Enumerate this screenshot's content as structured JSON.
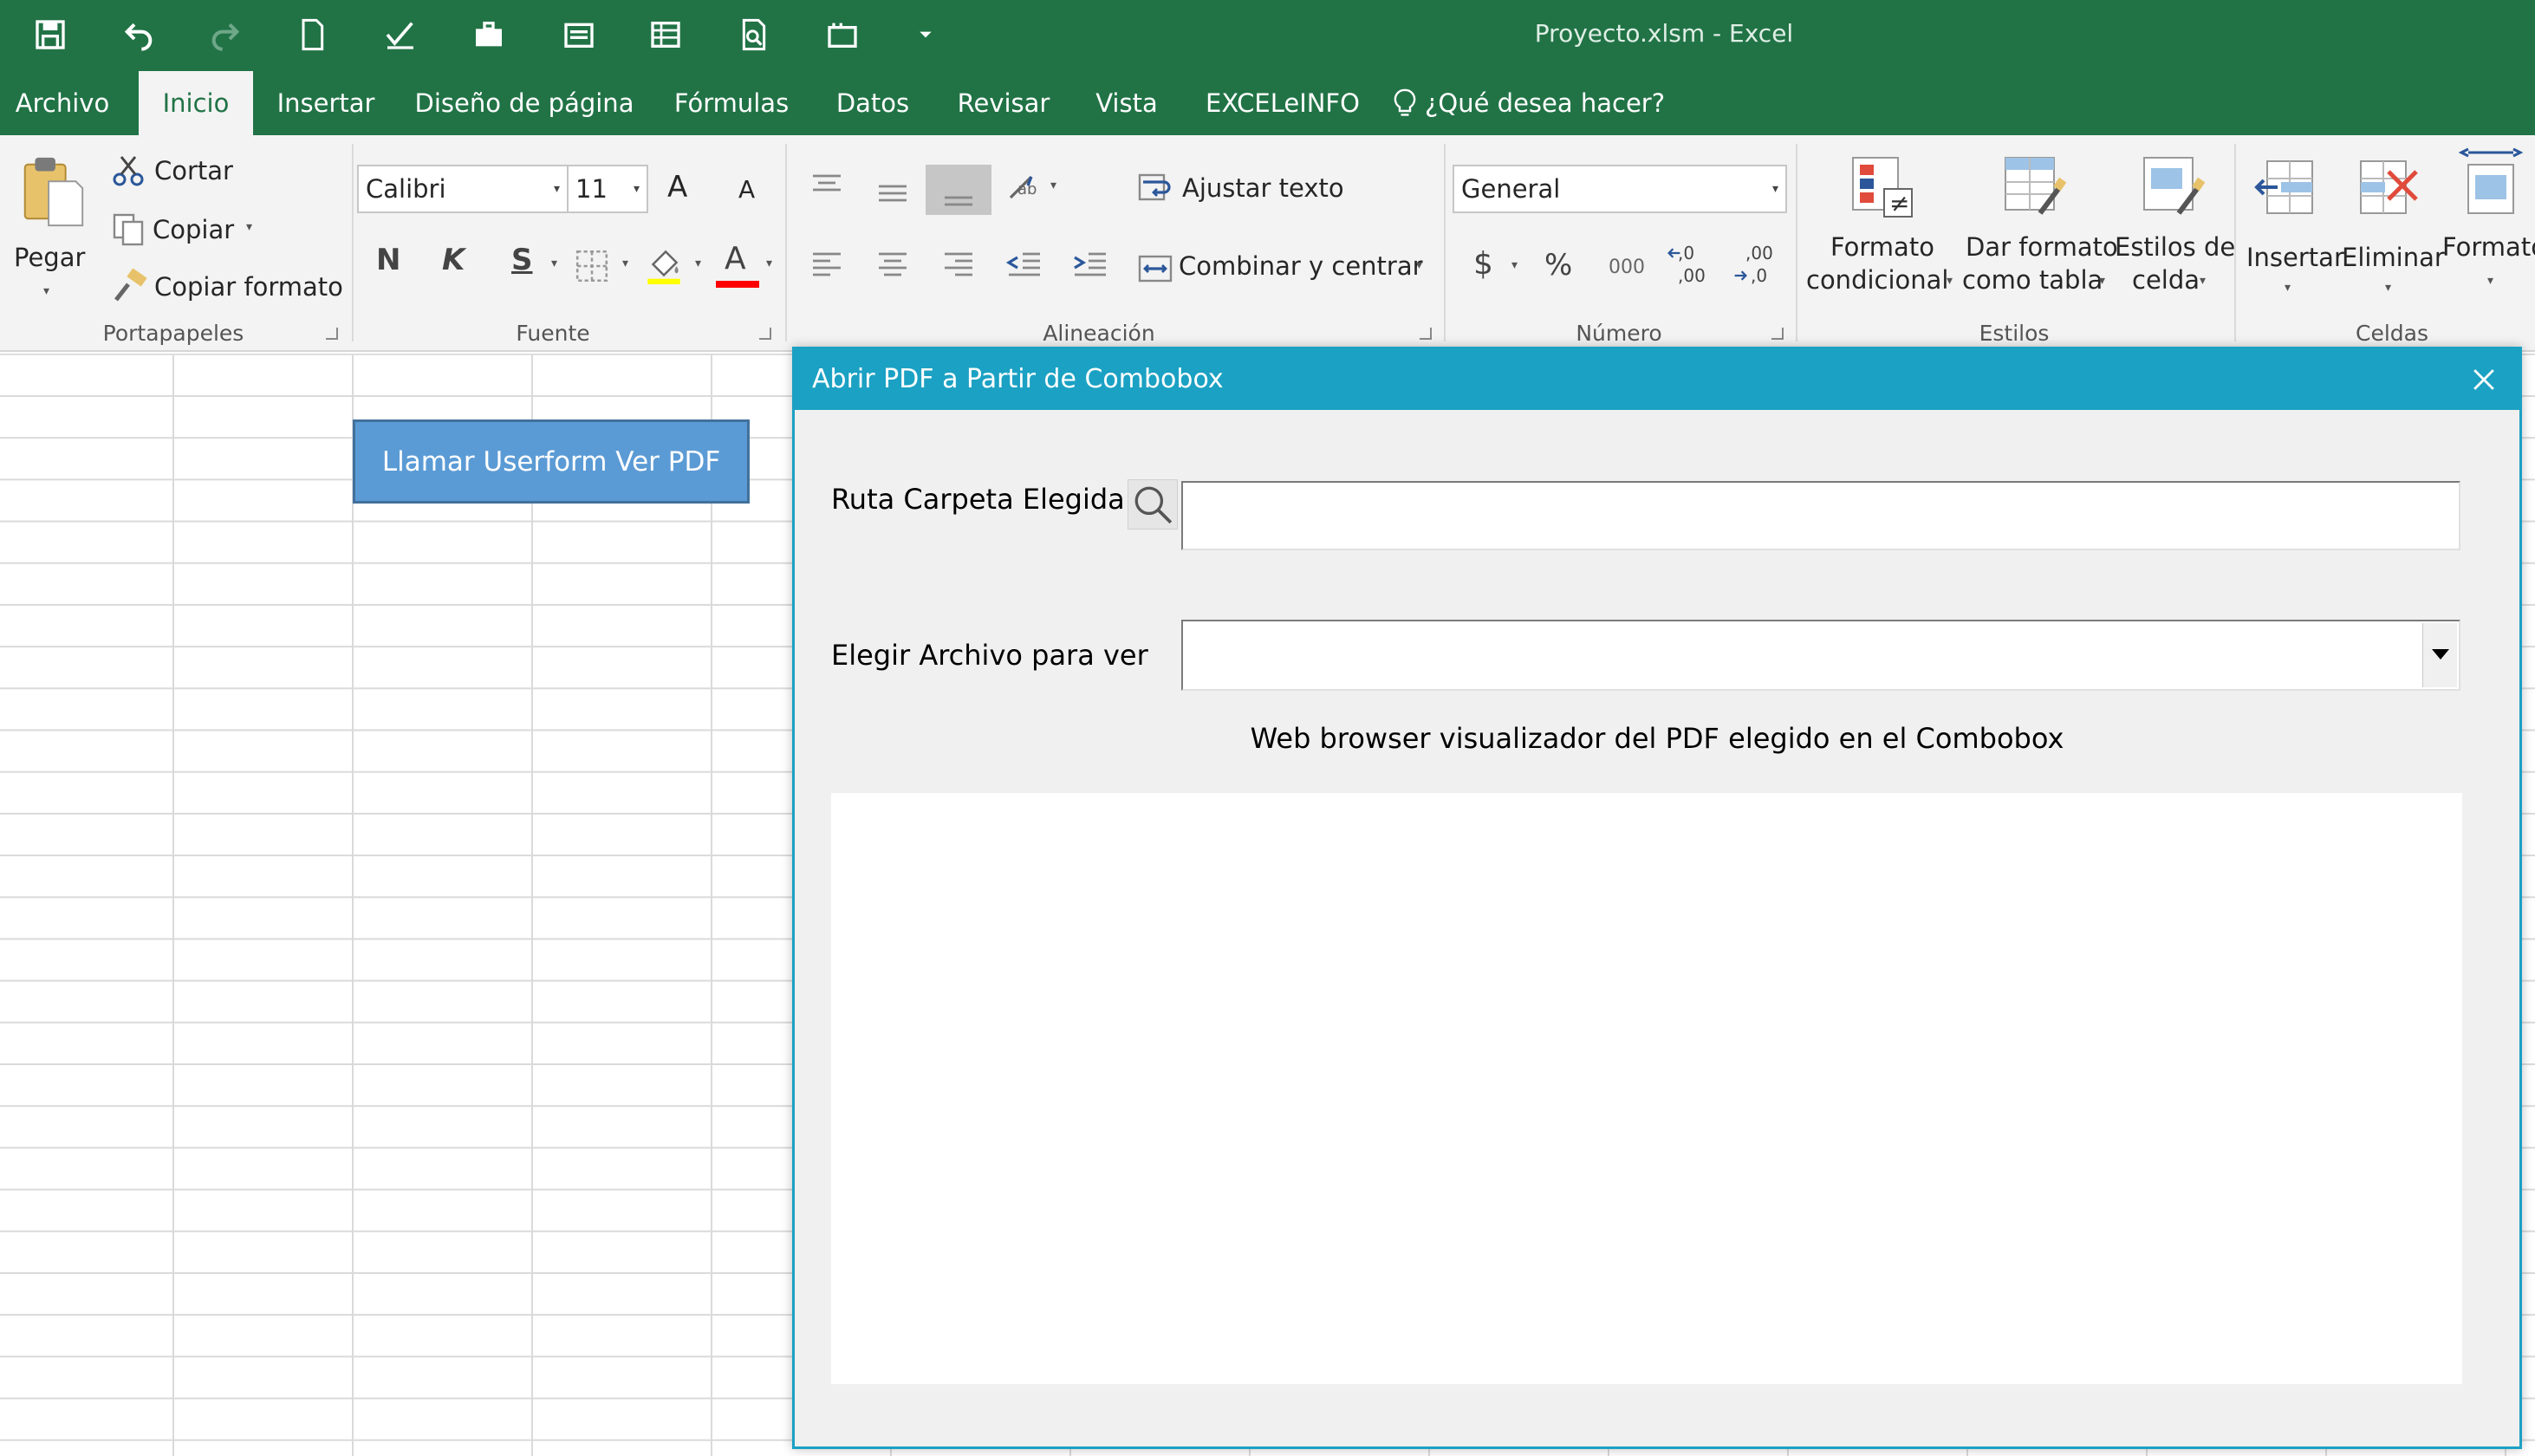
{
  "app": {
    "window_title": "Proyecto.xlsm - Excel"
  },
  "quick_access": {
    "icons": [
      "save-icon",
      "undo-icon",
      "redo-icon",
      "new-file-icon",
      "checkmark-edit-icon",
      "toolbox-icon",
      "form-icon",
      "table-icon",
      "print-preview-icon",
      "macro-icon",
      "customize-arrow-icon"
    ]
  },
  "tabs": [
    {
      "label": "Archivo"
    },
    {
      "label": "Inicio"
    },
    {
      "label": "Insertar"
    },
    {
      "label": "Diseño de página"
    },
    {
      "label": "Fórmulas"
    },
    {
      "label": "Datos"
    },
    {
      "label": "Revisar"
    },
    {
      "label": "Vista"
    },
    {
      "label": "EXCELeINFO"
    }
  ],
  "tell_me": "¿Qué desea hacer?",
  "ribbon": {
    "clipboard": {
      "paste": "Pegar",
      "cut": "Cortar",
      "copy": "Copiar",
      "format_painter": "Copiar formato",
      "group": "Portapapeles"
    },
    "font": {
      "font_name": "Calibri",
      "font_size": "11",
      "bold": "N",
      "italic": "K",
      "underline": "S",
      "grow": "A",
      "shrink": "A",
      "font_color_letter": "A",
      "group": "Fuente"
    },
    "alignment": {
      "wrap": "Ajustar texto",
      "merge": "Combinar y centrar",
      "group": "Alineación"
    },
    "number": {
      "format": "General",
      "currency": "$",
      "percent": "%",
      "thousands": "000",
      "inc_decimal": ",0",
      "inc_decimal_2": ",00",
      "dec_decimal": ",00",
      "dec_decimal_2": ",0",
      "group": "Número"
    },
    "styles": {
      "conditional_1": "Formato",
      "conditional_2": "condicional",
      "table_1": "Dar formato",
      "table_2": "como tabla",
      "cell_1": "Estilos de",
      "cell_2": "celda",
      "group": "Estilos"
    },
    "cells": {
      "insert": "Insertar",
      "delete": "Eliminar",
      "format": "Formato",
      "group": "Celdas"
    }
  },
  "sheet": {
    "macro_button": "Llamar Userform Ver PDF"
  },
  "dialog": {
    "title": "Abrir PDF a Partir de Combobox",
    "folder_label": "Ruta Carpeta Elegida",
    "folder_value": "",
    "file_label": "Elegir Archivo para ver",
    "file_value": "",
    "viewer_caption": "Web browser visualizador del PDF elegido en el Combobox"
  },
  "colors": {
    "excel_green": "#217346",
    "dialog_accent": "#1ba1c3",
    "button_blue": "#5b9bd5"
  }
}
